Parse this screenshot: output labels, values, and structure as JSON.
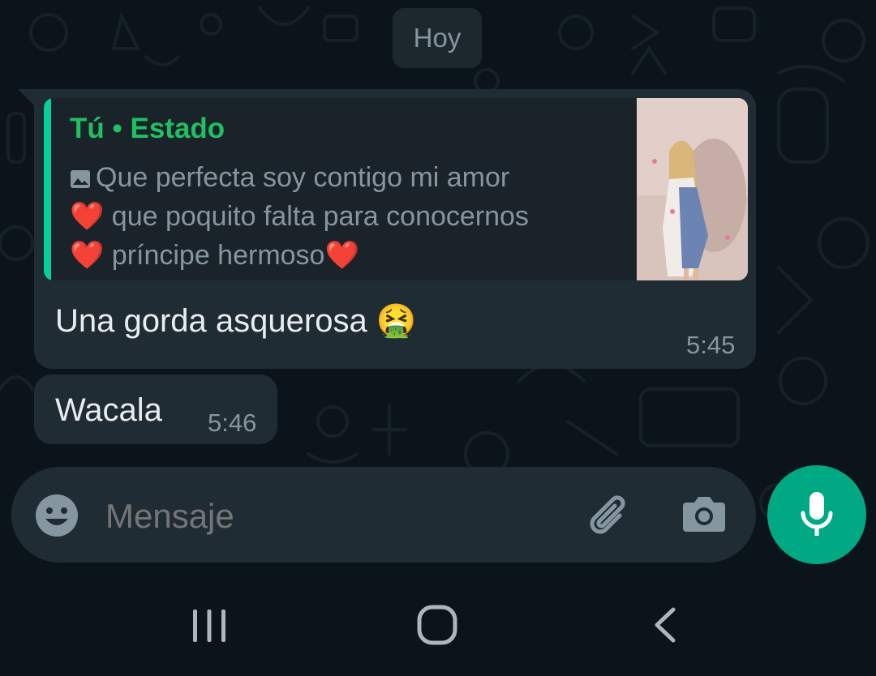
{
  "chat": {
    "date_separator": "Hoy",
    "messages": [
      {
        "quoted": {
          "sender": "Tú",
          "separator": "•",
          "source": "Estado",
          "caption_line1": "Que perfecta soy contigo mi amor",
          "caption_line2": "❤️ que poquito falta para conocernos",
          "caption_line3": "❤️ príncipe hermoso❤️",
          "thumbnail": "status-photo"
        },
        "text": "Una gorda asquerosa 🤮",
        "time": "5:45"
      },
      {
        "text": "Wacala",
        "time": "5:46"
      }
    ]
  },
  "composer": {
    "placeholder": "Mensaje",
    "emoji_icon": "emoji-icon",
    "attach_icon": "paperclip-icon",
    "camera_icon": "camera-icon",
    "mic_icon": "mic-icon"
  },
  "navbar": {
    "recents_icon": "recents-icon",
    "home_icon": "home-icon",
    "back_icon": "back-icon"
  },
  "colors": {
    "background": "#0b141a",
    "bubble": "#202c33",
    "accent": "#00a884",
    "quote_bar": "#06cf9c",
    "quote_title": "#21c063",
    "primary_text": "#e9edef",
    "secondary_text": "#8696a0"
  }
}
